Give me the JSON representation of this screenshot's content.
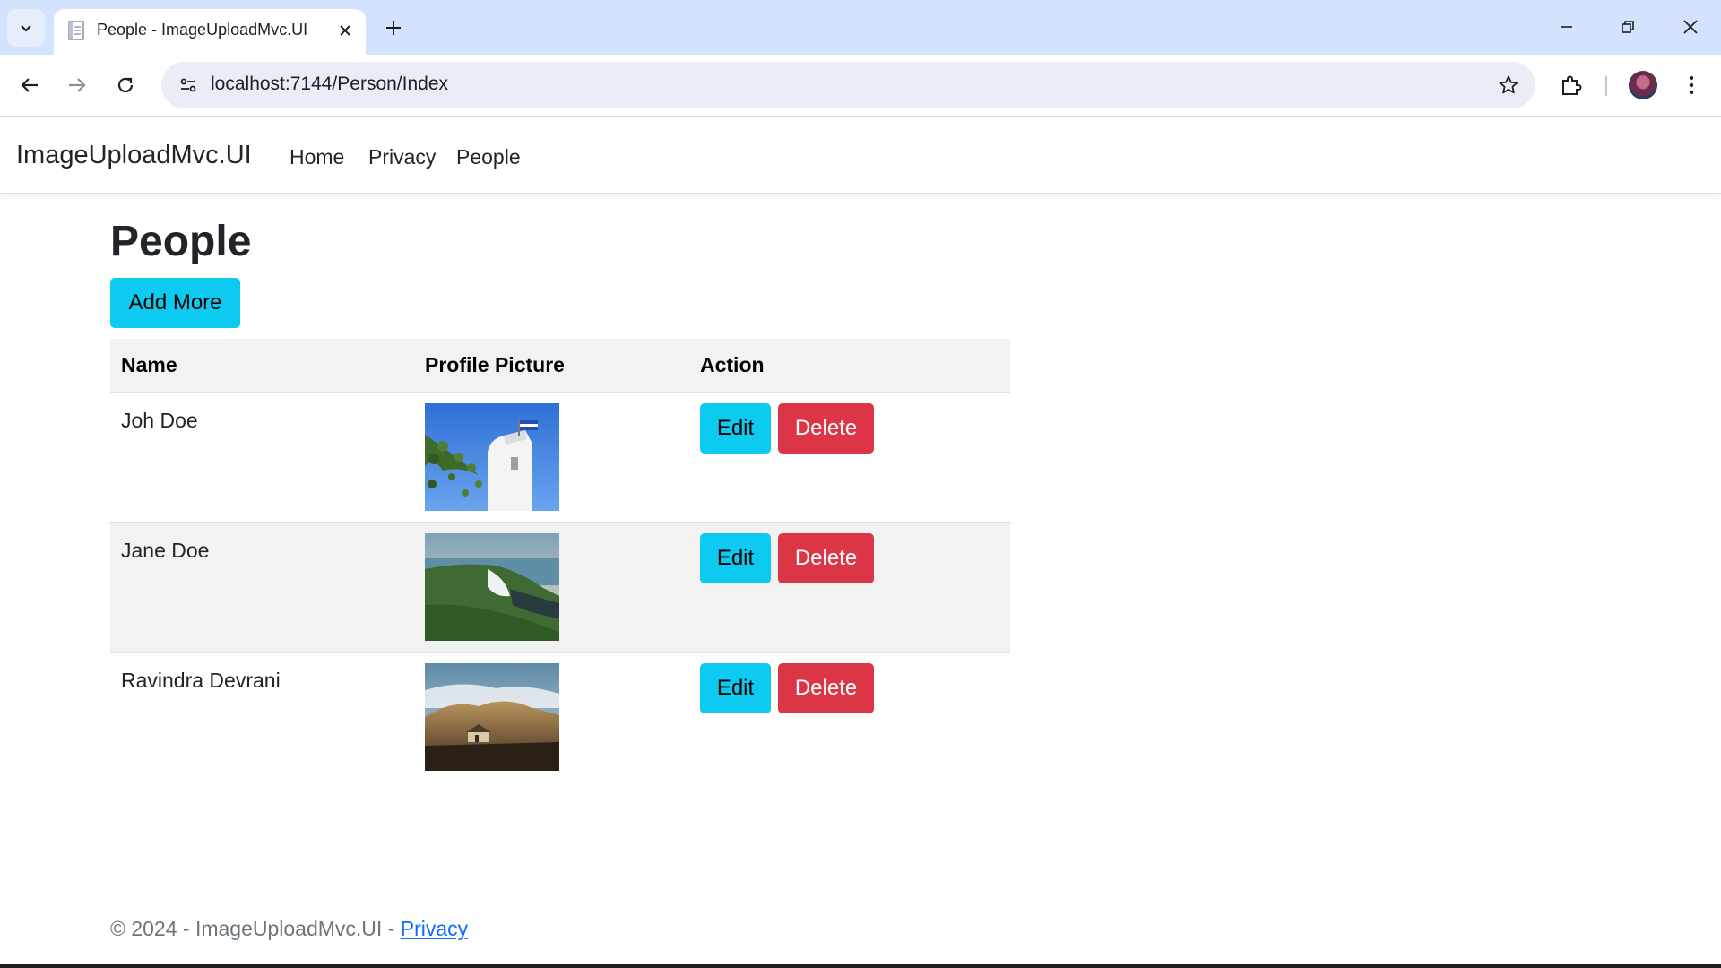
{
  "browser": {
    "tab_title": "People - ImageUploadMvc.UI",
    "url": "localhost:7144/Person/Index"
  },
  "navbar": {
    "brand": "ImageUploadMvc.UI",
    "links": [
      "Home",
      "Privacy",
      "People"
    ]
  },
  "main": {
    "title": "People",
    "add_button": "Add More",
    "table": {
      "headers": [
        "Name",
        "Profile Picture",
        "Action"
      ],
      "rows": [
        {
          "name": "Joh Doe",
          "picture": "white-chapel-with-flag-photo",
          "edit": "Edit",
          "delete": "Delete"
        },
        {
          "name": "Jane Doe",
          "picture": "green-coastal-cliffs-photo",
          "edit": "Edit",
          "delete": "Delete"
        },
        {
          "name": "Ravindra Devrani",
          "picture": "house-under-hills-photo",
          "edit": "Edit",
          "delete": "Delete"
        }
      ]
    }
  },
  "footer": {
    "prefix": "© 2024 - ImageUploadMvc.UI - ",
    "link": "Privacy"
  },
  "colors": {
    "tabstrip": "#d3e3fd",
    "info": "#0dcaf0",
    "danger": "#dc3545",
    "link": "#0d6efd",
    "stripe": "#f2f2f2"
  }
}
